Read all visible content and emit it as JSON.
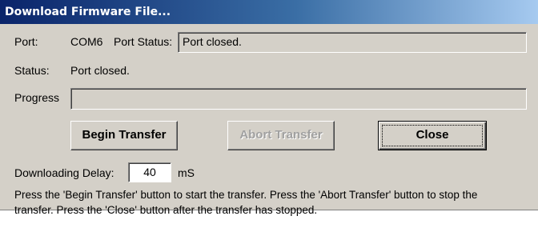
{
  "window": {
    "title": "Download Firmware File..."
  },
  "port": {
    "label": "Port:",
    "value": "COM6",
    "status_label": "Port Status:",
    "status_value": "Port closed."
  },
  "status": {
    "label": "Status:",
    "value": "Port closed."
  },
  "progress": {
    "label": "Progress",
    "fraction": 0
  },
  "buttons": {
    "begin": "Begin Transfer",
    "abort": "Abort Transfer",
    "close": "Close"
  },
  "delay": {
    "label": "Downloading Delay:",
    "value": "40",
    "unit": "mS"
  },
  "instructions": {
    "line1": "Press the 'Begin Transfer' button to start the transfer.  Press the 'Abort Transfer' button to stop the",
    "line2": "transfer.  Press the 'Close' button after the transfer has stopped."
  }
}
